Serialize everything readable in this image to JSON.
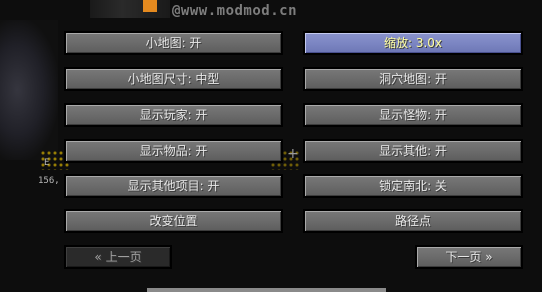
{
  "watermark": "@www.modmod.cn",
  "hud": {
    "coord_e": "E",
    "coord_n": "156,"
  },
  "buttons": {
    "minimap": "小地图: 开",
    "zoom": "缩放: 3.0x",
    "minimap_size": "小地图尺寸: 中型",
    "cave_map": "洞穴地图: 开",
    "show_players": "显示玩家: 开",
    "show_monsters": "显示怪物: 开",
    "show_items": "显示物品: 开",
    "show_others": "显示其他: 开",
    "show_other_entries": "显示其他项目: 开",
    "lock_north": "锁定南北: 关",
    "change_position": "改变位置",
    "waypoints": "路径点",
    "prev_page": "« 上一页",
    "next_page": "下一页 »"
  },
  "colors": {
    "button": "#6b6b6b",
    "button_hover": "#7c86c3",
    "button_disabled": "#2a2a2a",
    "hover_text": "#ffffa0"
  }
}
